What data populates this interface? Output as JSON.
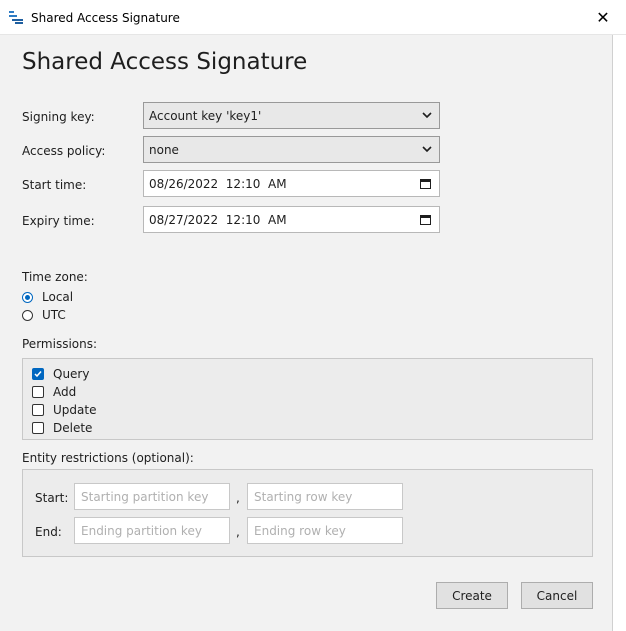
{
  "window": {
    "title": "Shared Access Signature",
    "close_glyph": "✕"
  },
  "dialog": {
    "heading": "Shared Access Signature",
    "signing_key": {
      "label": "Signing key:",
      "value": "Account key 'key1'"
    },
    "access_policy": {
      "label": "Access policy:",
      "value": "none"
    },
    "start_time": {
      "label": "Start time:",
      "value": "08/26/2022  12:10  AM"
    },
    "expiry_time": {
      "label": "Expiry time:",
      "value": "08/27/2022  12:10  AM"
    },
    "time_zone": {
      "label": "Time zone:",
      "options": [
        {
          "label": "Local",
          "selected": true
        },
        {
          "label": "UTC",
          "selected": false
        }
      ]
    },
    "permissions": {
      "label": "Permissions:",
      "items": [
        {
          "label": "Query",
          "checked": true
        },
        {
          "label": "Add",
          "checked": false
        },
        {
          "label": "Update",
          "checked": false
        },
        {
          "label": "Delete",
          "checked": false
        }
      ]
    },
    "entity_restrictions": {
      "label": "Entity restrictions (optional):",
      "start_label": "Start:",
      "end_label": "End:",
      "comma": ",",
      "start_partition_placeholder": "Starting partition key",
      "start_row_placeholder": "Starting row key",
      "end_partition_placeholder": "Ending partition key",
      "end_row_placeholder": "Ending row key"
    },
    "buttons": {
      "create": "Create",
      "cancel": "Cancel"
    }
  },
  "colors": {
    "accent": "#0067c0",
    "dialog_bg": "#f2f2f2",
    "placeholder": "#b0b0b0"
  }
}
